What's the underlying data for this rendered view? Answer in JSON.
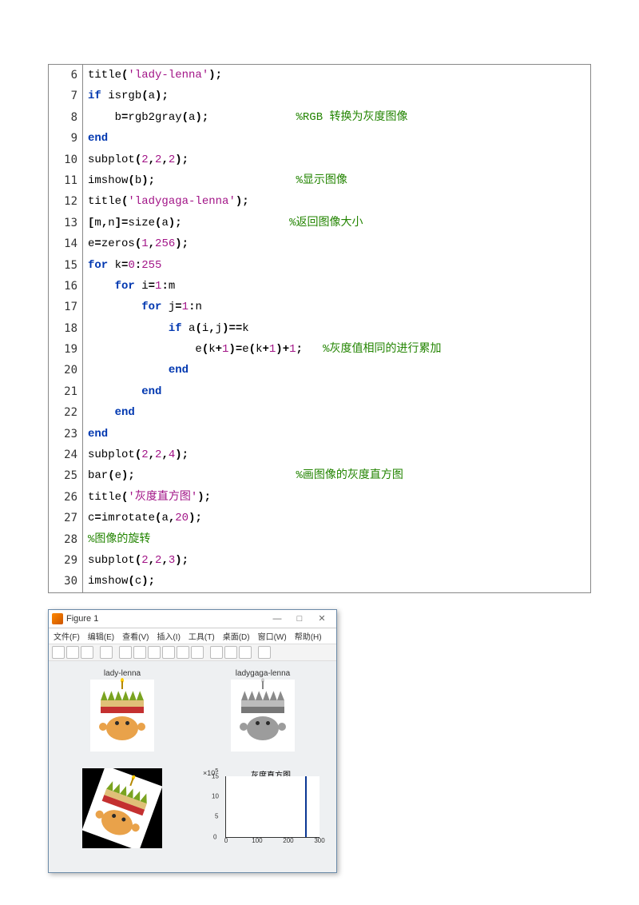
{
  "code": {
    "lines": [
      {
        "n": "6",
        "html": "title<span class='punct'>(</span><span class='string'>'lady-lenna'</span><span class='punct'>);</span>"
      },
      {
        "n": "7",
        "html": "<span class='keyword'>if</span> isrgb<span class='punct'>(</span>a<span class='punct'>);</span>"
      },
      {
        "n": "8",
        "html": "    b<span class='punct'>=</span>rgb2gray<span class='punct'>(</span>a<span class='punct'>);</span>             <span class='comment'>%RGB 转换为灰度图像</span>"
      },
      {
        "n": "9",
        "html": "<span class='keyword'>end</span>"
      },
      {
        "n": "10",
        "html": "subplot<span class='punct'>(</span><span class='number'>2</span><span class='punct'>,</span><span class='number'>2</span><span class='punct'>,</span><span class='number'>2</span><span class='punct'>);</span>"
      },
      {
        "n": "11",
        "html": "imshow<span class='punct'>(</span>b<span class='punct'>);</span>                     <span class='comment'>%显示图像</span>"
      },
      {
        "n": "12",
        "html": "title<span class='punct'>(</span><span class='string'>'ladygaga-lenna'</span><span class='punct'>);</span>"
      },
      {
        "n": "13",
        "html": "<span class='punct'>[</span>m<span class='punct'>,</span>n<span class='punct'>]=</span>size<span class='punct'>(</span>a<span class='punct'>);</span>                <span class='comment'>%返回图像大小</span>"
      },
      {
        "n": "14",
        "html": "e<span class='punct'>=</span>zeros<span class='punct'>(</span><span class='number'>1</span><span class='punct'>,</span><span class='number'>256</span><span class='punct'>);</span>"
      },
      {
        "n": "15",
        "html": "<span class='keyword'>for</span> k<span class='punct'>=</span><span class='number'>0</span><span class='punct'>:</span><span class='number'>255</span>"
      },
      {
        "n": "16",
        "html": "    <span class='keyword'>for</span> i<span class='punct'>=</span><span class='number'>1</span><span class='punct'>:</span>m"
      },
      {
        "n": "17",
        "html": "        <span class='keyword'>for</span> j<span class='punct'>=</span><span class='number'>1</span><span class='punct'>:</span>n"
      },
      {
        "n": "18",
        "html": "            <span class='keyword'>if</span> a<span class='punct'>(</span>i<span class='punct'>,</span>j<span class='punct'>)==</span>k"
      },
      {
        "n": "19",
        "html": "                e<span class='punct'>(</span>k<span class='punct'>+</span><span class='number'>1</span><span class='punct'>)=</span>e<span class='punct'>(</span>k<span class='punct'>+</span><span class='number'>1</span><span class='punct'>)+</span><span class='number'>1</span><span class='punct'>;</span>   <span class='comment'>%灰度值相同的进行累加</span>"
      },
      {
        "n": "20",
        "html": "            <span class='keyword'>end</span>"
      },
      {
        "n": "21",
        "html": "        <span class='keyword'>end</span>"
      },
      {
        "n": "22",
        "html": "    <span class='keyword'>end</span>"
      },
      {
        "n": "23",
        "html": "<span class='keyword'>end</span>"
      },
      {
        "n": "24",
        "html": "subplot<span class='punct'>(</span><span class='number'>2</span><span class='punct'>,</span><span class='number'>2</span><span class='punct'>,</span><span class='number'>4</span><span class='punct'>);</span>"
      },
      {
        "n": "25",
        "html": "bar<span class='punct'>(</span>e<span class='punct'>);</span>                        <span class='comment'>%画图像的灰度直方图</span>"
      },
      {
        "n": "26",
        "html": "title<span class='punct'>(</span><span class='string'>'灰度直方图'</span><span class='punct'>);</span>"
      },
      {
        "n": "27",
        "html": "c<span class='punct'>=</span>imrotate<span class='punct'>(</span>a<span class='punct'>,</span><span class='number'>20</span><span class='punct'>);</span>"
      },
      {
        "n": "28",
        "html": "<span class='comment'>%图像的旋转</span>"
      },
      {
        "n": "29",
        "html": "subplot<span class='punct'>(</span><span class='number'>2</span><span class='punct'>,</span><span class='number'>2</span><span class='punct'>,</span><span class='number'>3</span><span class='punct'>);</span>"
      },
      {
        "n": "30",
        "html": "imshow<span class='punct'>(</span>c<span class='punct'>);</span>"
      }
    ]
  },
  "figure": {
    "window_title": "Figure 1",
    "menus": [
      "文件(F)",
      "编辑(E)",
      "查看(V)",
      "插入(I)",
      "工具(T)",
      "桌面(D)",
      "窗口(W)",
      "帮助(H)"
    ],
    "win_min": "—",
    "win_max": "□",
    "win_close": "✕",
    "subplot1_title": "lady-lenna",
    "subplot2_title": "ladygaga-lenna",
    "subplot4_title": "灰度直方图",
    "ylabel_prefix": "×10",
    "ylabel_exp": "5"
  },
  "chart_data": {
    "type": "bar",
    "title": "灰度直方图",
    "xlabel": "",
    "ylabel": "×10^5",
    "xlim": [
      0,
      300
    ],
    "ylim": [
      0,
      15
    ],
    "x_ticks": [
      0,
      100,
      200,
      300
    ],
    "y_ticks": [
      0,
      5,
      10,
      15
    ],
    "categories_note": "0..255 intensity bins; only one dominant bar visible near ~255",
    "bars": [
      {
        "x": 255,
        "value": 15
      }
    ]
  }
}
